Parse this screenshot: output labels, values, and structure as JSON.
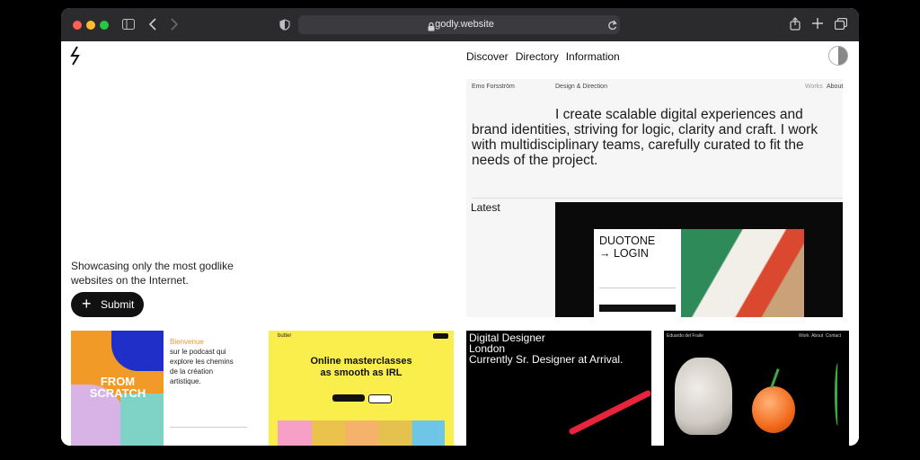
{
  "browser": {
    "url": "godly.website",
    "icons": [
      "sidebar-icon",
      "back-icon",
      "forward-icon",
      "shield-icon",
      "lock-icon",
      "reload-icon",
      "share-icon",
      "new-tab-icon",
      "tabs-icon"
    ]
  },
  "nav": {
    "items": [
      "Discover",
      "Directory",
      "Information"
    ]
  },
  "hero": {
    "tagline": "Showcasing only the most godlike websites on the Internet.",
    "submit_label": "Submit"
  },
  "featured": {
    "author": "Emo Forsström",
    "role": "Design & Direction",
    "works": "Works",
    "about": "About",
    "intro": "I create scalable digital experiences and brand identities, striving for logic, clarity and craft. I work with multidisciplinary teams, carefully curated to fit the needs of the project.",
    "latest_label": "Latest",
    "latest_title": "DUOTONE LOGIN",
    "latest_title_line1": "DUOTONE",
    "latest_title_line2": "LOGIN"
  },
  "thumbs": {
    "t1": {
      "art_line1": "FROM",
      "art_line2": "SCRATCH",
      "heading": "Bienvenue",
      "body": "sur le podcast qui explore les chemins de la création artistique."
    },
    "t2": {
      "brand": "butter",
      "title": "Online masterclasses as smooth as IRL"
    },
    "t3": {
      "line1": "Digital Designer",
      "line2": "London",
      "line3": "Currently Sr. Designer at Arrival."
    },
    "t4": {
      "brand": "Eduardo del Fraile",
      "menu": "Work  About  Contact"
    }
  },
  "colors": {
    "accent_red": "#e8243c",
    "butter_yellow": "#f9ee4b",
    "scratch_orange": "#f29a28"
  }
}
